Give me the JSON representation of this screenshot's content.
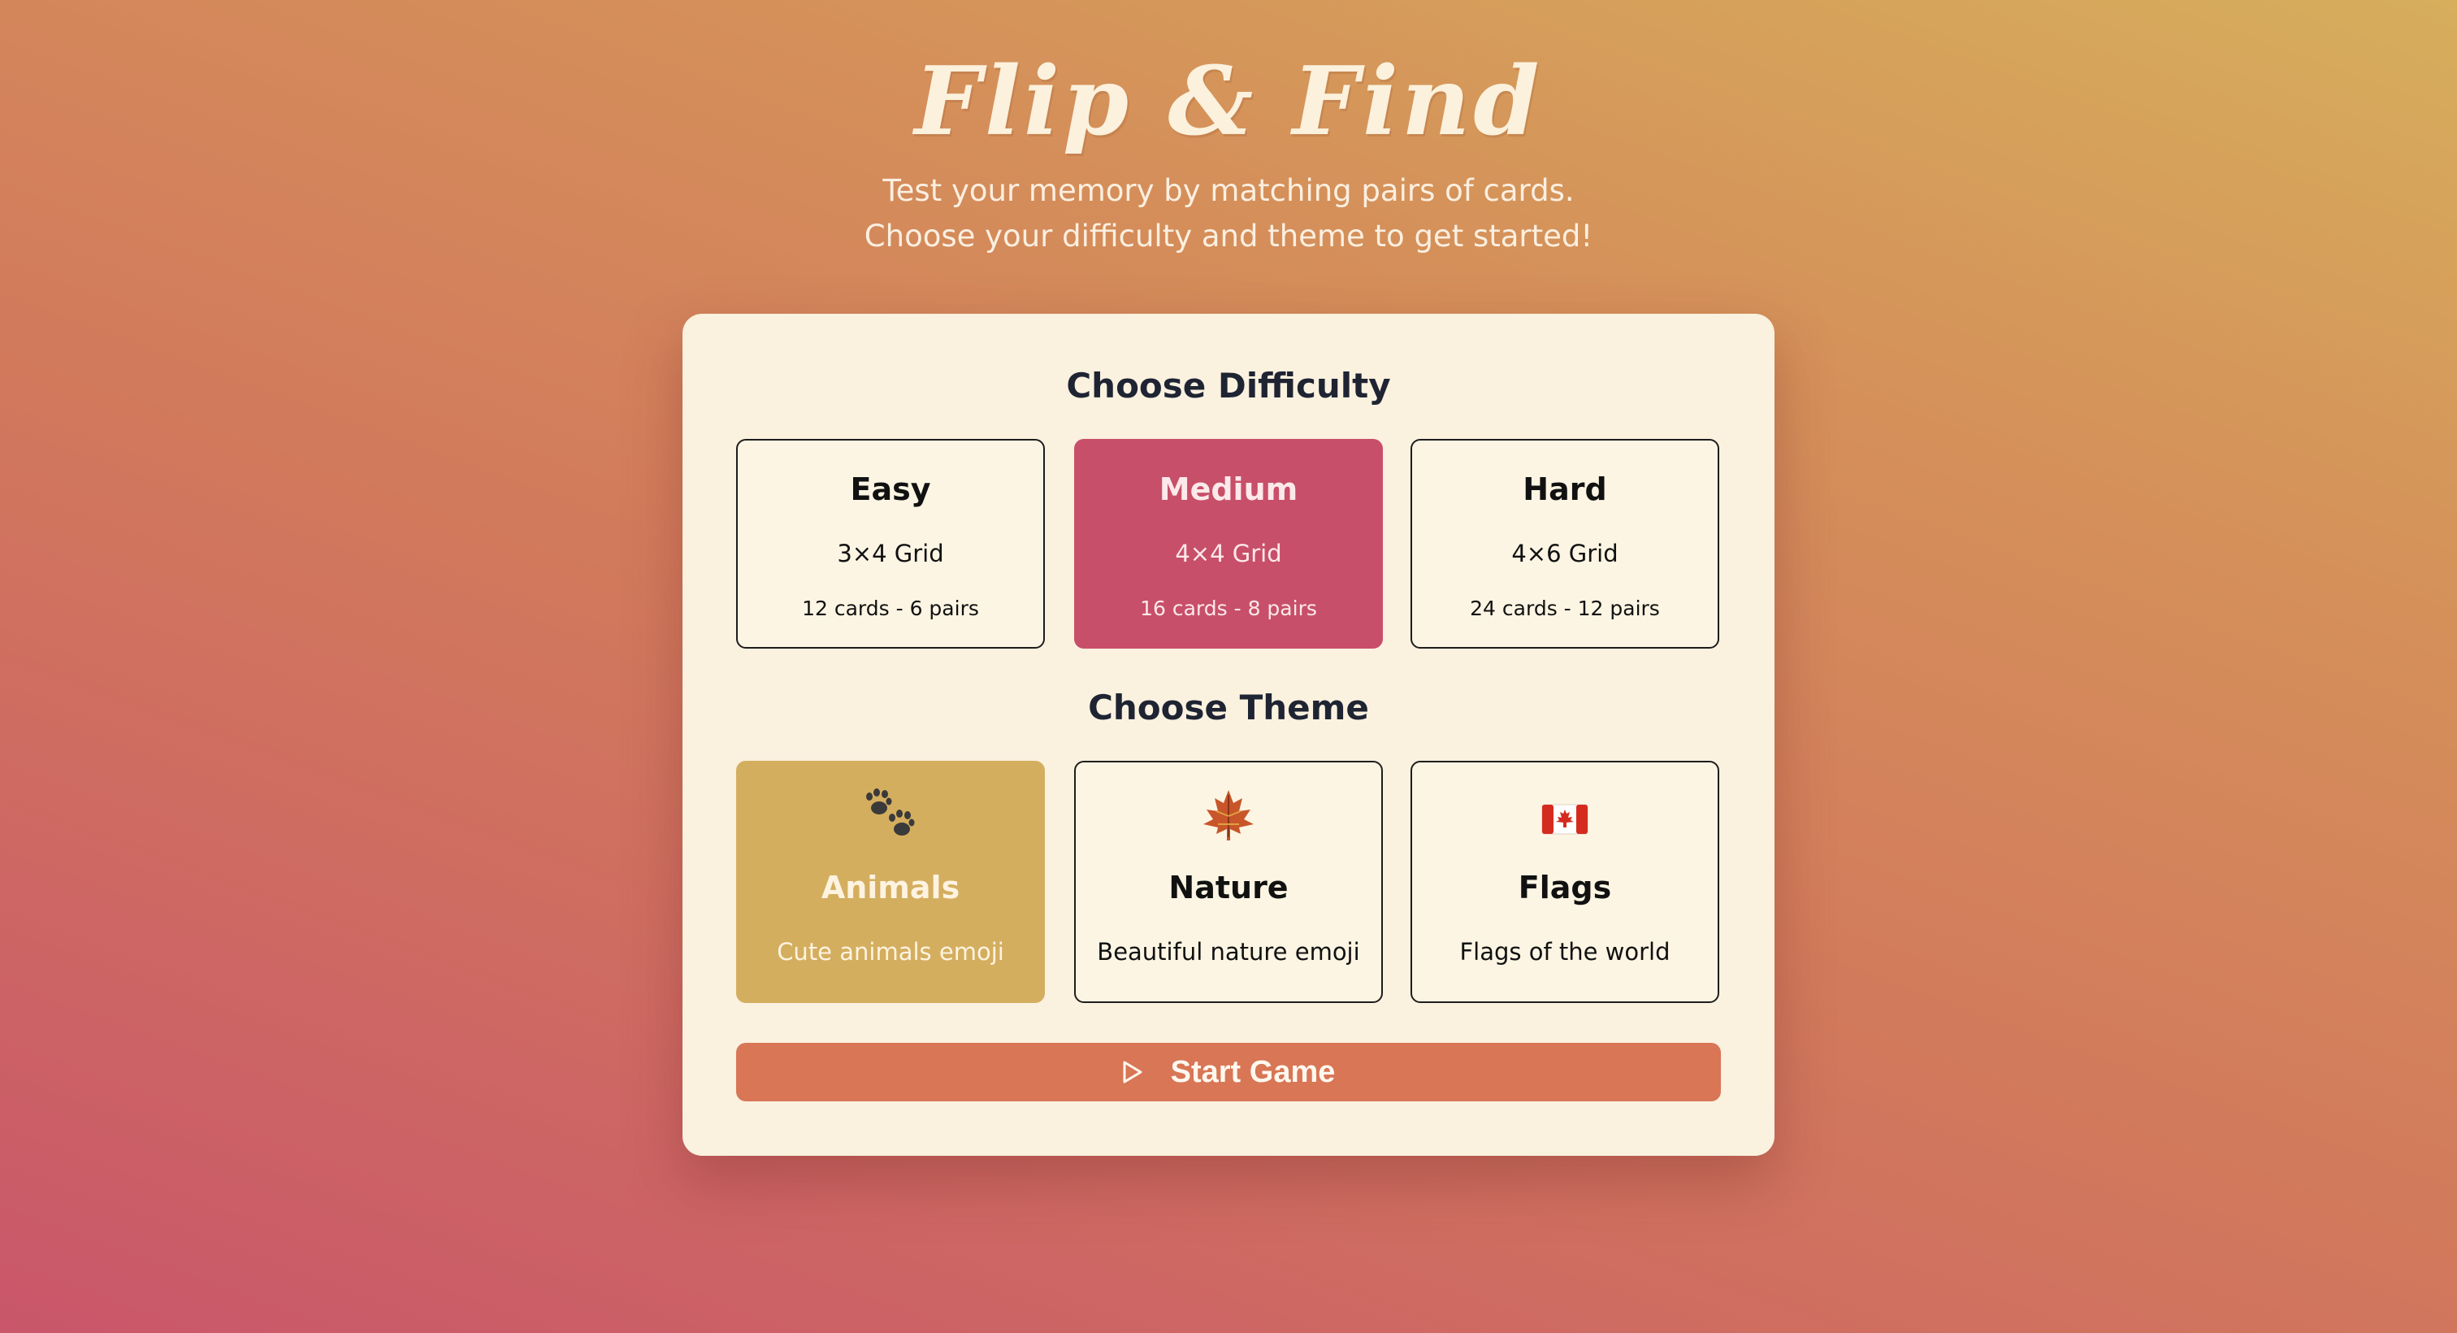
{
  "header": {
    "title": "Flip & Find",
    "subtitle_line1": "Test your memory by matching pairs of cards.",
    "subtitle_line2": "Choose your difficulty and theme to get started!"
  },
  "difficulty": {
    "heading": "Choose Difficulty",
    "selected": "Medium",
    "options": [
      {
        "name": "Easy",
        "grid": "3×4 Grid",
        "cards": "12 cards - 6 pairs"
      },
      {
        "name": "Medium",
        "grid": "4×4 Grid",
        "cards": "16 cards - 8 pairs"
      },
      {
        "name": "Hard",
        "grid": "4×6 Grid",
        "cards": "24 cards - 12 pairs"
      }
    ]
  },
  "theme": {
    "heading": "Choose Theme",
    "selected": "Animals",
    "options": [
      {
        "name": "Animals",
        "description": "Cute animals emoji",
        "icon": "paw-prints-icon"
      },
      {
        "name": "Nature",
        "description": "Beautiful nature emoji",
        "icon": "maple-leaf-icon"
      },
      {
        "name": "Flags",
        "description": "Flags of the world",
        "icon": "canada-flag-icon"
      }
    ]
  },
  "start_button": {
    "label": "Start Game",
    "icon": "play-icon"
  },
  "colors": {
    "selected_difficulty": "#c84f69",
    "selected_theme": "#d4ae5f",
    "start_button": "#d87655",
    "panel": "#faf1df"
  }
}
